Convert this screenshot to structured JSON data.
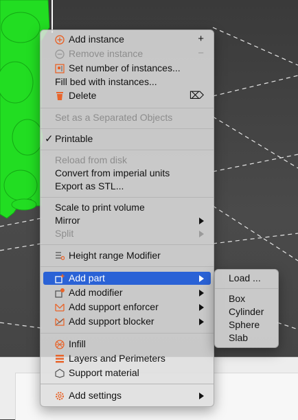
{
  "main_menu": {
    "add_instance": "Add instance",
    "add_instance_shortcut": "+",
    "remove_instance": "Remove instance",
    "remove_instance_shortcut": "−",
    "set_number": "Set number of instances...",
    "fill_bed": "Fill bed with instances...",
    "delete": "Delete",
    "delete_shortcut": "⌦",
    "set_separated": "Set as a Separated Objects",
    "printable": "Printable",
    "printable_check": "✓",
    "reload": "Reload from disk",
    "convert": "Convert from imperial units",
    "export_stl": "Export as STL...",
    "scale": "Scale to print volume",
    "mirror": "Mirror",
    "split": "Split",
    "height_range": "Height range Modifier",
    "add_part": "Add part",
    "add_modifier": "Add modifier",
    "add_enforcer": "Add support enforcer",
    "add_blocker": "Add support blocker",
    "infill": "Infill",
    "layers": "Layers and Perimeters",
    "support_material": "Support material",
    "add_settings": "Add settings"
  },
  "sub_menu": {
    "load": "Load ...",
    "box": "Box",
    "cylinder": "Cylinder",
    "sphere": "Sphere",
    "slab": "Slab"
  },
  "colors": {
    "highlight": "#2a62d6",
    "model_green": "#22dd22",
    "accent_orange": "#e8642a"
  }
}
